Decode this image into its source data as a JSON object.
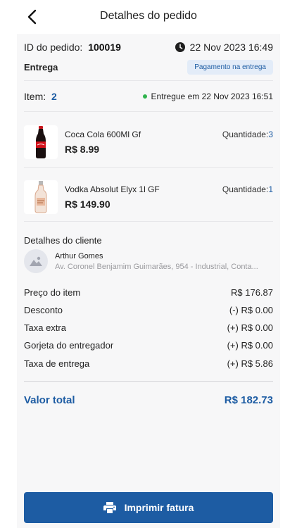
{
  "header": {
    "title": "Detalhes do pedido"
  },
  "order": {
    "id_label": "ID do pedido:",
    "id_value": "100019",
    "date": "22 Nov 2023  16:49",
    "type": "Entrega",
    "payment_badge": "Pagamento na entrega",
    "items_label": "Item:",
    "items_count": "2",
    "delivered_text": "Entregue em 22 Nov 2023  16:51"
  },
  "products": [
    {
      "name": "Coca Cola 600Ml Gf",
      "price": "R$ 8.99",
      "qty_label": "Quantidade:",
      "qty": "3",
      "icon": "coca-cola-bottle"
    },
    {
      "name": "Vodka Absolut Elyx 1l GF",
      "price": "R$ 149.90",
      "qty_label": "Quantidade:",
      "qty": "1",
      "icon": "vodka-bottle"
    }
  ],
  "customer": {
    "section_title": "Detalhes do cliente",
    "name": "Arthur Gomes",
    "address": "Av. Coronel Benjamim Guimarães, 954 - Industrial, Conta..."
  },
  "summary": [
    {
      "label": "Preço do item",
      "value": "R$ 176.87"
    },
    {
      "label": "Desconto",
      "value": "(-) R$ 0.00"
    },
    {
      "label": "Taxa extra",
      "value": "(+) R$ 0.00"
    },
    {
      "label": "Gorjeta do entregador",
      "value": "(+) R$ 0.00"
    },
    {
      "label": "Taxa de entrega",
      "value": "(+) R$ 5.86"
    }
  ],
  "total": {
    "label": "Valor total",
    "value": "R$ 182.73"
  },
  "print_button": {
    "label": "Imprimir fatura"
  },
  "colors": {
    "accent": "#1d5ca3",
    "badge_bg": "#e3ecf8",
    "status_green": "#2fb34c",
    "card_bg": "#f7f7f8"
  }
}
